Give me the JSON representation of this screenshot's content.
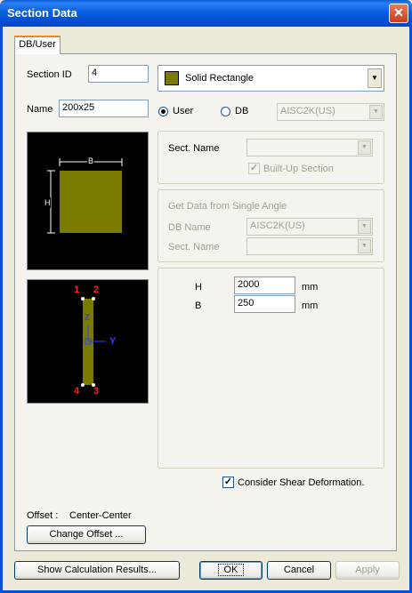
{
  "window": {
    "title": "Section Data",
    "close": "✕"
  },
  "tab": {
    "label": "DB/User"
  },
  "section": {
    "id_label": "Section ID",
    "id_value": "4",
    "name_label": "Name",
    "name_value": "200x25",
    "shape": "Solid Rectangle",
    "shape_color": "#7a7b00"
  },
  "source": {
    "user_label": "User",
    "db_label": "DB",
    "db_value": "AISC2K(US)",
    "selected": "User"
  },
  "sect_group": {
    "sect_name_label": "Sect. Name",
    "built_up_label": "Built-Up Section"
  },
  "angle_group": {
    "title": "Get Data from Single Angle",
    "db_name_label": "DB Name",
    "db_name_value": "AISC2K(US)",
    "sect_name_label": "Sect. Name"
  },
  "dims": {
    "h_label": "H",
    "h_value": "2000",
    "h_unit": "mm",
    "b_label": "B",
    "b_value": "250",
    "b_unit": "mm"
  },
  "preview": {
    "dim_b": "B",
    "dim_h": "H",
    "z_axis": "Z",
    "y_axis": "Y",
    "pts": [
      "1",
      "2",
      "3",
      "4"
    ]
  },
  "shear": {
    "label": "Consider Shear Deformation.",
    "checked": true
  },
  "offset": {
    "label": "Offset :",
    "value": "Center-Center",
    "button": "Change Offset ..."
  },
  "buttons": {
    "show_calc": "Show Calculation Results...",
    "ok": "OK",
    "cancel": "Cancel",
    "apply": "Apply"
  }
}
